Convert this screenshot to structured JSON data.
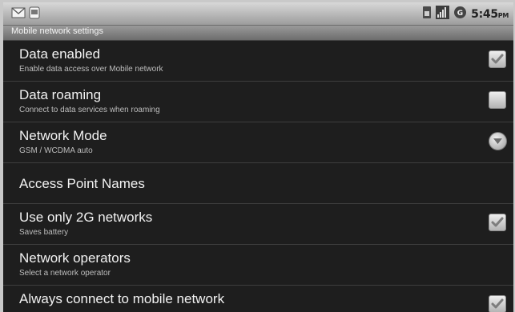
{
  "status_bar": {
    "time": "5:45",
    "ampm": "PM",
    "icons": [
      "gmail-icon",
      "notification-icon",
      "sim-icon",
      "signal-icon",
      "data-3g-icon"
    ]
  },
  "title_bar": {
    "title": "Mobile network settings"
  },
  "items": [
    {
      "title": "Data enabled",
      "summary": "Enable data access over Mobile network",
      "control": "checkbox",
      "checked": true
    },
    {
      "title": "Data roaming",
      "summary": "Connect to data services when roaming",
      "control": "checkbox",
      "checked": false
    },
    {
      "title": "Network Mode",
      "summary": "GSM / WCDMA auto",
      "control": "dropdown-arrow"
    },
    {
      "title": "Access Point Names",
      "summary": "",
      "control": "none"
    },
    {
      "title": "Use only 2G networks",
      "summary": "Saves battery",
      "control": "checkbox",
      "checked": true
    },
    {
      "title": "Network operators",
      "summary": "Select a network operator",
      "control": "none"
    },
    {
      "title": "Always connect to mobile network",
      "summary": "",
      "control": "checkbox",
      "checked": true
    }
  ],
  "colors": {
    "background": "#1e1e1e",
    "title_text": "#f2f2f2",
    "summary_text": "#bdbdbd",
    "divider": "#3e3e3e"
  }
}
